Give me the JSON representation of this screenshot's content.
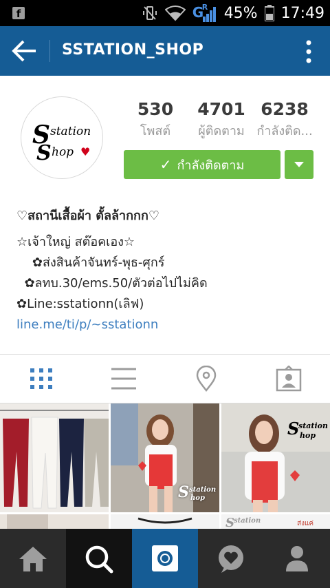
{
  "status_bar": {
    "facebook_icon": "f",
    "battery": "45%",
    "time": "17:49",
    "network_label": "G",
    "network_sub": "R"
  },
  "app_bar": {
    "title": "SSTATION_SHOP",
    "back_icon": "back-arrow-icon",
    "menu_icon": "more-vertical-icon"
  },
  "profile": {
    "avatar_text": {
      "line1_big": "S",
      "line1": "station",
      "line2_big": "S",
      "line2": "hop",
      "heart": "♥"
    },
    "stats": [
      {
        "count": "530",
        "label": "โพสต์"
      },
      {
        "count": "4701",
        "label": "ผู้ติดตาม"
      },
      {
        "count": "6238",
        "label": "กำลังติด..."
      }
    ],
    "follow_button": {
      "check": "✓",
      "label": "กำลังติดตาม"
    },
    "bio": {
      "name": "♡สถานีเสื้อผ้า ตั้ลล้ากกก♡",
      "lines": [
        "☆เจ้าใหญ่ สต๊อคเอง☆",
        "    ✿ส่งสินค้าจันทร์-พุธ-ศุกร์",
        "  ✿ลทบ.30/ems.50/ตัวต่อไปไม่คิด",
        "✿Line:sstationn(เลิฟ)"
      ],
      "link": "line.me/ti/p/~sstationn"
    }
  },
  "tabs": [
    {
      "name": "grid-view",
      "icon": "grid-icon",
      "active": true
    },
    {
      "name": "list-view",
      "icon": "list-icon",
      "active": false
    },
    {
      "name": "location",
      "icon": "location-pin-icon",
      "active": false
    },
    {
      "name": "tagged",
      "icon": "tagged-person-icon",
      "active": false
    }
  ],
  "grid": {
    "watermark_big": "S",
    "watermark_1": "station",
    "watermark_2": "hop",
    "partial_text": "ส่งแค่"
  },
  "bottom_nav": [
    {
      "name": "home",
      "icon": "home-icon"
    },
    {
      "name": "search",
      "icon": "search-icon"
    },
    {
      "name": "camera",
      "icon": "camera-icon"
    },
    {
      "name": "activity",
      "icon": "heart-bubble-icon"
    },
    {
      "name": "profile",
      "icon": "person-icon"
    }
  ],
  "colors": {
    "app_bar": "#155c95",
    "follow_green": "#6cbd45",
    "link_blue": "#3d7ebf",
    "active_tab": "#3d7ebf",
    "nav_bg": "#2b2b2b"
  }
}
